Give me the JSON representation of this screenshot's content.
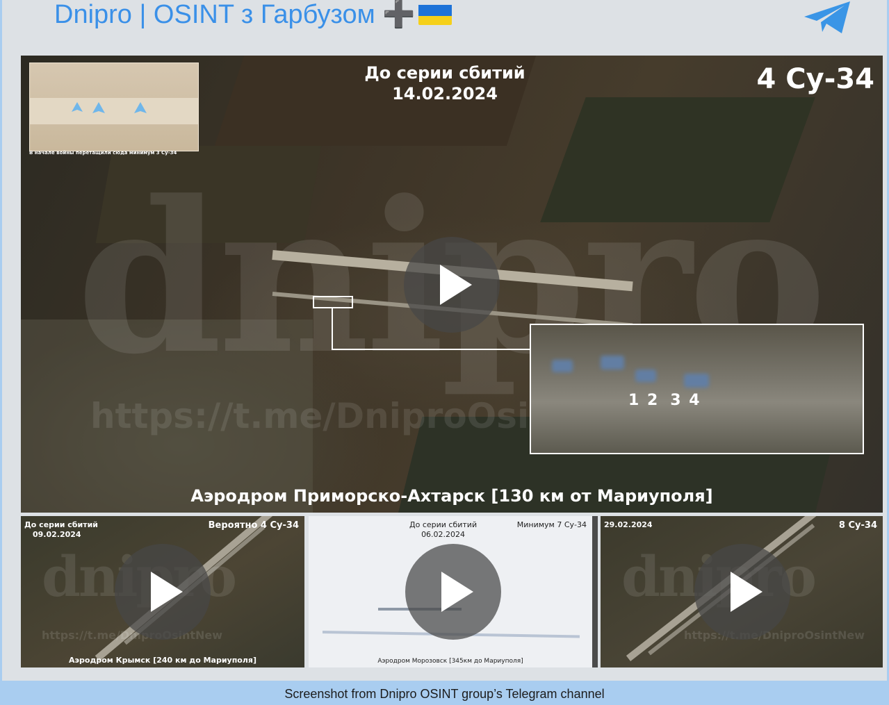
{
  "channel": {
    "title": "Dnipro | OSINT з Гарбузом ➕",
    "accent_color": "#3a90e8",
    "flag_icon": "ukraine-flag",
    "logo_icon": "telegram-logo"
  },
  "main_video": {
    "date_line1": "До серии сбитий",
    "date_line2": "14.02.2024",
    "count": "4 Су-34",
    "inset_caption": "В начале войны перетащили сюда минимум 3 Су-34",
    "zoom_numbers": [
      "1 2",
      "3 4"
    ],
    "caption": "Аэродром Приморско-Ахтарск [130 км от Мариуполя]",
    "watermark_url": "https://t.me/DniproOsintNew",
    "watermark_logo": "dnipro"
  },
  "thumbnails": [
    {
      "date_line1": "До серии сбитий",
      "date_line2": "09.02.2024",
      "count": "Вероятно 4 Су-34",
      "caption": "Аэродром Крымск [240 км до Мариуполя]",
      "watermark_url": "https://t.me/DniproOsintNew"
    },
    {
      "date_line1": "До серии сбитий",
      "date_line2": "06.02.2024",
      "count": "Минимум 7 Су-34",
      "caption": "Аэродром Морозовск [345км до Мариуполя]"
    },
    {
      "date_line1": "29.02.2024",
      "date_line2": "",
      "count": "8 Су-34",
      "caption": "",
      "watermark_url": "https://t.me/DniproOsintNew"
    }
  ],
  "caption_bar": {
    "text": "Screenshot from Dnipro OSINT group’s Telegram channel",
    "color": "#a9cdf0"
  }
}
